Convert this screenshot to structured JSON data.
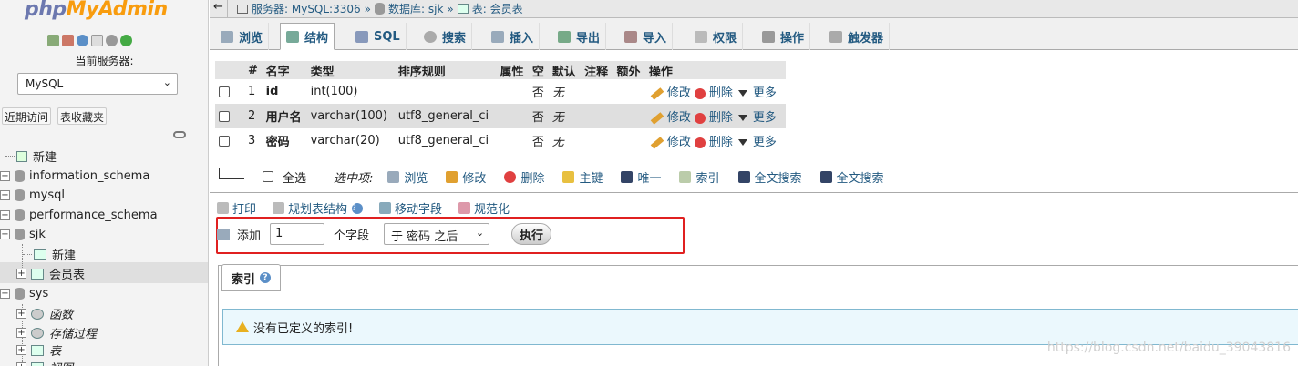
{
  "sidebar": {
    "logo_php": "php",
    "logo_myadmin": "MyAdmin",
    "server_label": "当前服务器:",
    "server_select": "MySQL",
    "recent_button": "近期访问",
    "favorites_button": "表收藏夹",
    "tree": {
      "new": "新建",
      "db1": "information_schema",
      "db2": "mysql",
      "db3": "performance_schema",
      "db4": "sjk",
      "db4_new": "新建",
      "db4_table": "会员表",
      "db5": "sys",
      "sys_functions": "函数",
      "sys_procedures": "存储过程",
      "sys_tables": "表",
      "sys_views": "视图"
    }
  },
  "breadcrumb": {
    "back": "←",
    "server": "服务器: MySQL:3306",
    "sep1": "»",
    "database": "数据库: sjk",
    "sep2": "»",
    "table": "表: 会员表"
  },
  "tabs": [
    {
      "label": "浏览"
    },
    {
      "label": "结构"
    },
    {
      "label": "SQL"
    },
    {
      "label": "搜索"
    },
    {
      "label": "插入"
    },
    {
      "label": "导出"
    },
    {
      "label": "导入"
    },
    {
      "label": "权限"
    },
    {
      "label": "操作"
    },
    {
      "label": "触发器"
    }
  ],
  "structure": {
    "headers": [
      "#",
      "名字",
      "类型",
      "排序规则",
      "属性",
      "空",
      "默认",
      "注释",
      "额外",
      "操作"
    ],
    "rows": [
      {
        "num": "1",
        "name": "id",
        "type": "int(100)",
        "collation": "",
        "null": "否",
        "default": "无"
      },
      {
        "num": "2",
        "name": "用户名",
        "type": "varchar(100)",
        "collation": "utf8_general_ci",
        "null": "否",
        "default": "无"
      },
      {
        "num": "3",
        "name": "密码",
        "type": "varchar(20)",
        "collation": "utf8_general_ci",
        "null": "否",
        "default": "无"
      }
    ],
    "actions": {
      "edit": "修改",
      "delete": "删除",
      "more": "更多"
    }
  },
  "with_selected": {
    "check_all": "全选",
    "label": "选中项:",
    "items": [
      "浏览",
      "修改",
      "删除",
      "主键",
      "唯一",
      "索引",
      "全文搜索",
      "全文搜索"
    ]
  },
  "tools": [
    "打印",
    "规划表结构",
    "移动字段",
    "规范化"
  ],
  "add_field": {
    "label": "添加",
    "count": "1",
    "unit": "个字段",
    "position": "于 密码 之后",
    "go": "执行"
  },
  "indexes": {
    "tab": "索引",
    "notice": "没有已定义的索引!"
  },
  "watermark": "https://blog.csdn.net/baidu_39043816"
}
